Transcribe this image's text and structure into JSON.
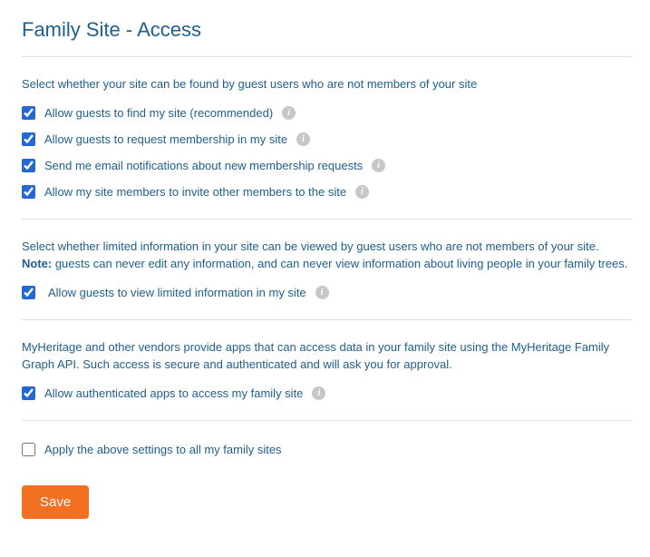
{
  "page_title": "Family Site - Access",
  "section1": {
    "intro": "Select whether your site can be found by guest users who are not members of your site",
    "options": [
      {
        "label": "Allow guests to find my site (recommended)",
        "checked": true,
        "info": true
      },
      {
        "label": "Allow guests to request membership in my site",
        "checked": true,
        "info": true
      },
      {
        "label": "Send me email notifications about new membership requests",
        "checked": true,
        "info": true
      },
      {
        "label": "Allow my site members to invite other members to the site",
        "checked": true,
        "info": true
      }
    ]
  },
  "section2": {
    "intro_line1": "Select whether limited information in your site can be viewed by guest users who are not members of your site.",
    "note_label": "Note:",
    "intro_line2": " guests can never edit any information, and can never view information about living people in your family trees.",
    "option": {
      "label": "Allow guests to view limited information in my site",
      "checked": true,
      "info": true
    }
  },
  "section3": {
    "intro": "MyHeritage and other vendors provide apps that can access data in your family site using the MyHeritage Family Graph API. Such access is secure and authenticated and will ask you for approval.",
    "option": {
      "label": "Allow authenticated apps to access my family site",
      "checked": true,
      "info": true
    }
  },
  "section4": {
    "option": {
      "label": "Apply the above settings to all my family sites",
      "checked": false,
      "info": false
    }
  },
  "save_button": "Save",
  "info_glyph": "i"
}
